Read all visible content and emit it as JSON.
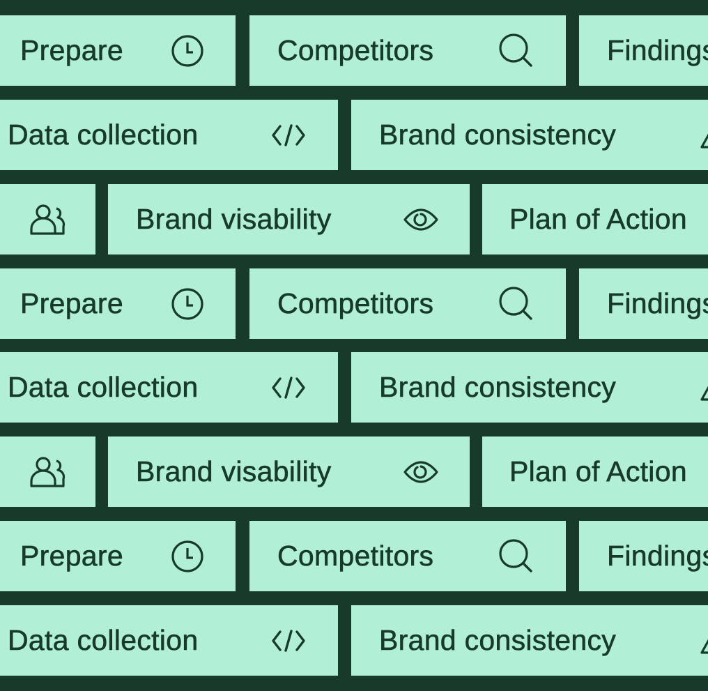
{
  "colors": {
    "background": "#173a2a",
    "tile": "#b1efd6",
    "text": "#173a2a"
  },
  "pattern": {
    "row_a": [
      {
        "label": "Prepare",
        "icon": "clock-icon"
      },
      {
        "label": "Competitors",
        "icon": "search-icon"
      },
      {
        "label": "Findings",
        "icon": ""
      }
    ],
    "row_b": [
      {
        "label": "Data collection",
        "icon": "code-icon"
      },
      {
        "label": "Brand consistency",
        "icon": "warning-icon"
      }
    ],
    "row_c": [
      {
        "label": "",
        "icon": "users-icon"
      },
      {
        "label": "Brand visability",
        "icon": "eye-icon"
      },
      {
        "label": "Plan of Action",
        "icon": ""
      }
    ]
  }
}
